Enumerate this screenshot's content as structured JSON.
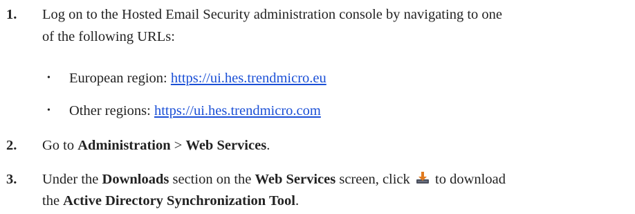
{
  "steps": [
    {
      "number": "1.",
      "line1": "Log on to the Hosted Email Security administration console by navigating to one",
      "line2": "of the following URLs:",
      "bullets": [
        {
          "label": "European region: ",
          "url": "https://ui.hes.trendmicro.eu"
        },
        {
          "label": "Other regions: ",
          "url": "https://ui.hes.trendmicro.com"
        }
      ]
    },
    {
      "number": "2.",
      "pre": "Go to ",
      "b1": "Administration",
      "sep": " > ",
      "b2": "Web Services",
      "post": "."
    },
    {
      "number": "3.",
      "pre": "Under the ",
      "b1": "Downloads",
      "mid1": " section on the ",
      "b2": "Web Services",
      "mid2": " screen, click ",
      "icon": "download-icon",
      "mid3": " to download",
      "line2_pre": "the ",
      "b3": "Active Directory Synchronization Tool",
      "line2_post": "."
    }
  ]
}
